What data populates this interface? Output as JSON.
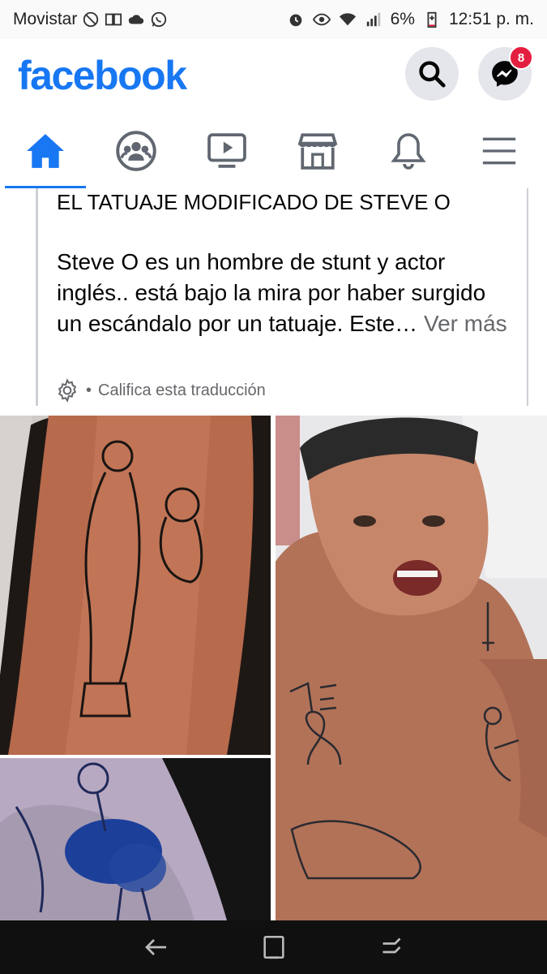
{
  "status_bar": {
    "carrier": "Movistar",
    "battery": "6%",
    "time": "12:51 p. m."
  },
  "header": {
    "logo": "facebook",
    "messenger_badge": "8"
  },
  "nav": {
    "items": [
      "home-icon",
      "groups-icon",
      "watch-icon",
      "marketplace-icon",
      "notifications-icon",
      "menu-icon"
    ],
    "accent": "#1877f2"
  },
  "post": {
    "title": "EL TATUAJE MODIFICADO DE STEVE O",
    "body": "Steve O es un hombre de stunt y actor inglés.. está bajo la mira por haber surgido un escándalo por un tatuaje. Este…",
    "see_more": "Ver más",
    "rate_translation": "Califica esta traducción"
  },
  "colors": {
    "brand": "#1877f2",
    "badge": "#e41e3f"
  }
}
